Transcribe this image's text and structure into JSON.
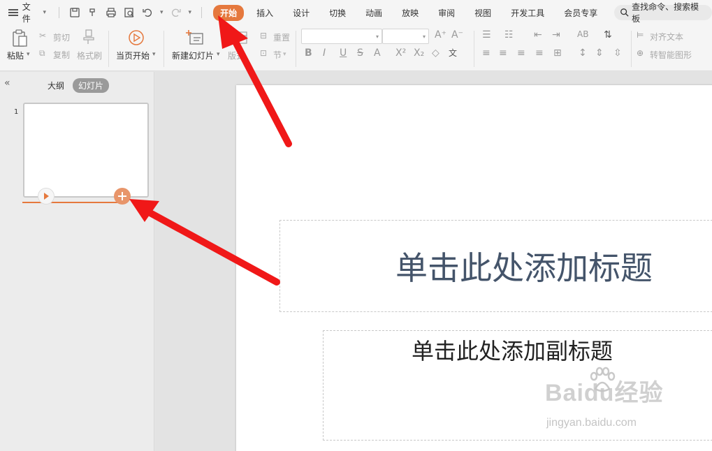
{
  "menubar": {
    "file_label": "文件",
    "tabs": [
      {
        "label": "开始",
        "active": true
      },
      {
        "label": "插入"
      },
      {
        "label": "设计"
      },
      {
        "label": "切换"
      },
      {
        "label": "动画"
      },
      {
        "label": "放映"
      },
      {
        "label": "审阅"
      },
      {
        "label": "视图"
      },
      {
        "label": "开发工具"
      },
      {
        "label": "会员专享"
      }
    ],
    "search_label": "查找命令、搜索模板",
    "accent_color": "#e5783d"
  },
  "ribbon": {
    "paste": "粘贴",
    "cut": "剪切",
    "copy": "复制",
    "format_painter": "格式刷",
    "play_from_current": "当页开始",
    "new_slide": "新建幻灯片",
    "layout": "版式",
    "reset": "重置",
    "section": "节",
    "align_text": "对齐文本",
    "convert_smartart": "转智能图形"
  },
  "leftpane": {
    "tab_outline": "大纲",
    "tab_slides": "幻灯片",
    "slide_number": "1"
  },
  "slide": {
    "title_placeholder": "单击此处添加标题",
    "subtitle_placeholder": "单击此处添加副标题"
  },
  "watermark": {
    "main": "Baidu经验",
    "sub": "jingyan.baidu.com"
  }
}
